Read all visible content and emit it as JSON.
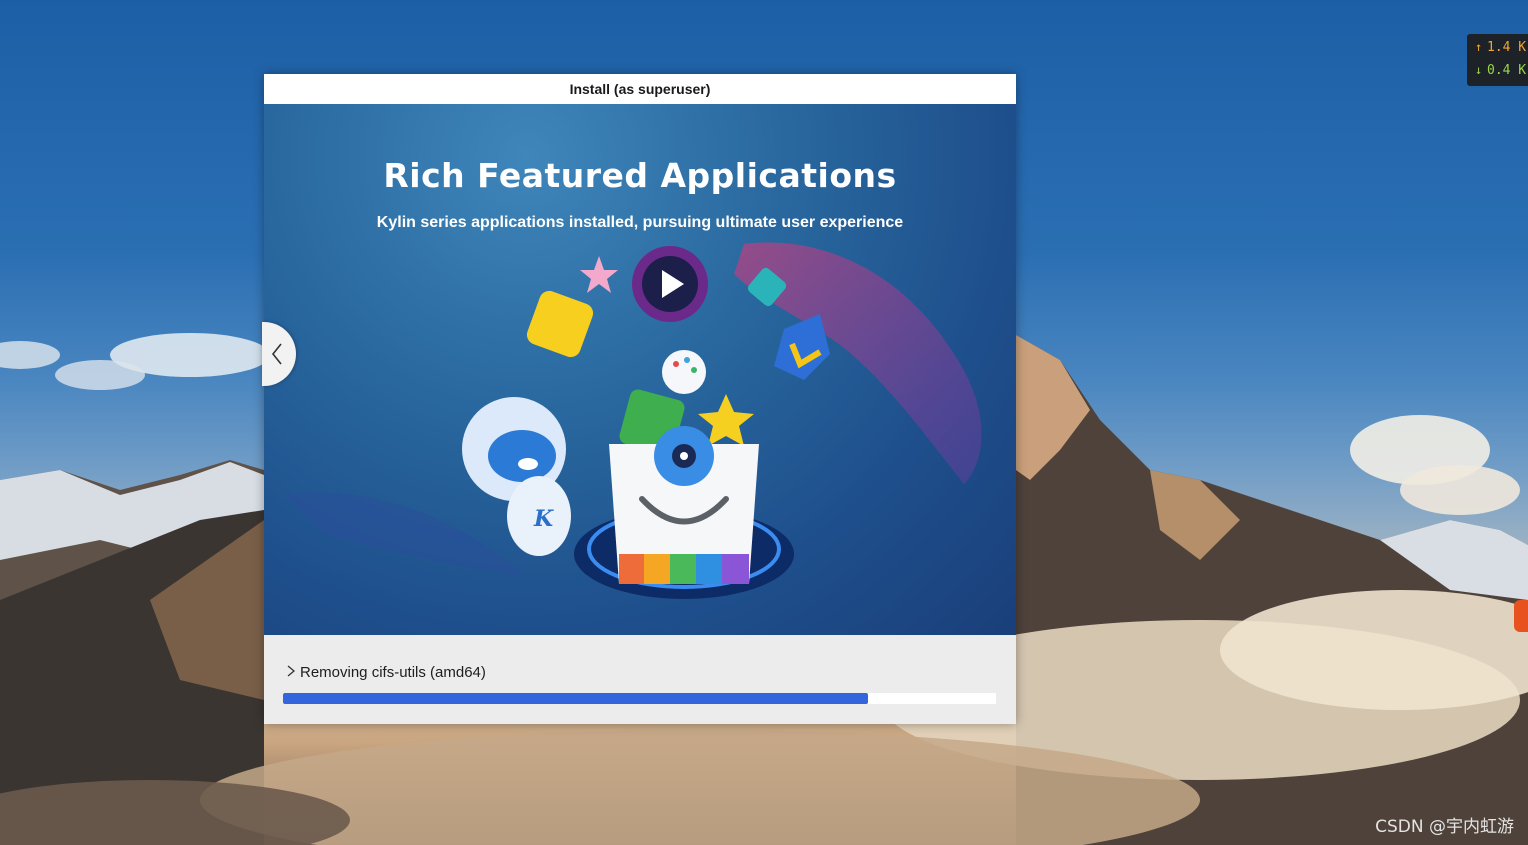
{
  "desktop": {
    "net_speed": {
      "upload": "1.4 K",
      "download": "0.4 K"
    },
    "watermark": "CSDN @宇内虹游"
  },
  "dialog": {
    "title": "Install (as superuser)",
    "slide": {
      "title": "Rich Featured Applications",
      "subtitle": "Kylin series applications installed, pursuing ultimate user experience"
    },
    "status": {
      "text": "Removing cifs-utils (amd64)",
      "progress": 0.82
    }
  },
  "icons": {
    "prev": "chevron-left-icon",
    "expander": "chevron-right-icon",
    "upload": "arrow-up-icon",
    "download": "arrow-down-icon"
  },
  "colors": {
    "progress": "#3366dd",
    "upload": "#f0a636",
    "download": "#9cd44a"
  }
}
